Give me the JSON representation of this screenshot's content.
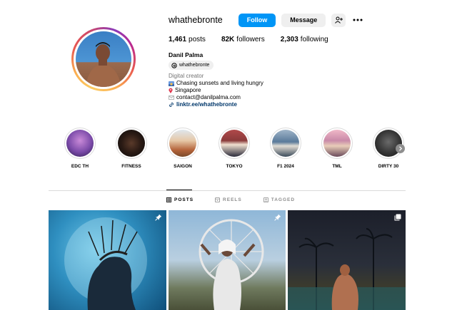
{
  "profile": {
    "username": "whathebronte",
    "follow_label": "Follow",
    "message_label": "Message",
    "full_name": "Danil Palma",
    "threads_handle": "whathebronte"
  },
  "stats": {
    "posts_count": "1,461",
    "posts_label": "posts",
    "followers_count": "82K",
    "followers_label": "followers",
    "following_count": "2,303",
    "following_label": "following"
  },
  "bio": {
    "category": "Digital creator",
    "line1": "Chasing sunsets and living hungry",
    "line2": "Singapore",
    "line3": "contact@danilpalma.com",
    "link": "linktr.ee/whathebronte"
  },
  "highlights": [
    {
      "label": "EDC TH",
      "color": "#7a4aa8"
    },
    {
      "label": "FITNESS",
      "color": "#1e1e1e"
    },
    {
      "label": "SAIGON",
      "color": "#c9a27a"
    },
    {
      "label": "TOKYO",
      "color": "#8a3a3a"
    },
    {
      "label": "F1 2024",
      "color": "#4a6a8a"
    },
    {
      "label": "TML",
      "color": "#c98aa8"
    },
    {
      "label": "DIRTY 30",
      "color": "#3a3a3a"
    }
  ],
  "tabs": {
    "posts": "POSTS",
    "reels": "REELS",
    "tagged": "TAGGED"
  },
  "icons": [
    "add-person-icon",
    "more-icon",
    "threads-icon",
    "pin-icon",
    "grid-icon",
    "reels-icon",
    "tagged-icon",
    "link-icon",
    "carousel-icon",
    "chevron-right-icon"
  ],
  "colors": {
    "follow_button": "#0095f6",
    "link": "#00376b"
  }
}
